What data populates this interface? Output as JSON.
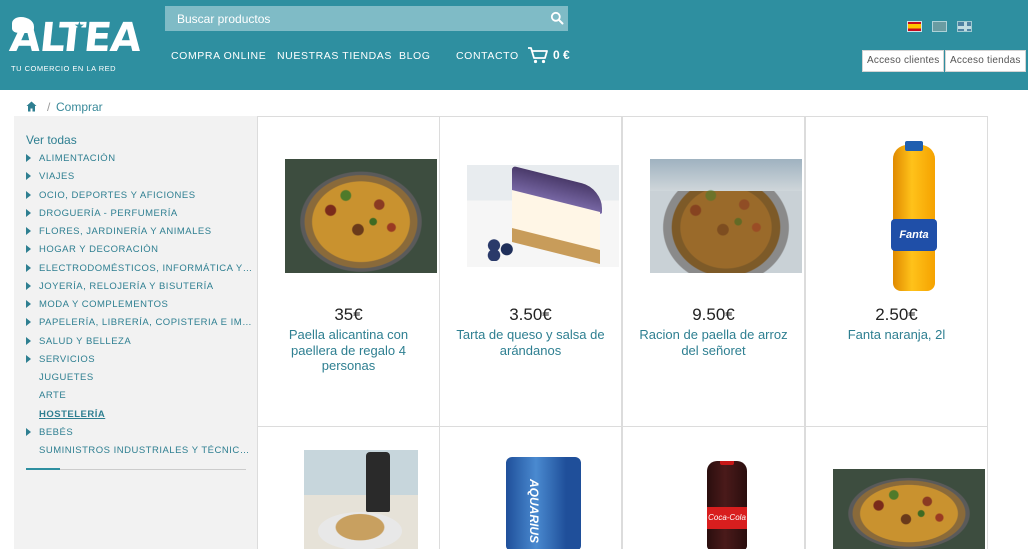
{
  "header": {
    "logo_text": "ALTEA",
    "logo_tagline": "TU COMERCIO EN LA RED",
    "search_placeholder": "Buscar productos",
    "nav": [
      "COMPRA ONLINE",
      "NUESTRAS TIENDAS",
      "BLOG",
      "CONTACTO"
    ],
    "cart_total": "0 €",
    "languages": [
      "es",
      "va",
      "en"
    ],
    "buttons": {
      "clientes": "Acceso clientes",
      "tiendas": "Acceso tiendas"
    }
  },
  "breadcrumb": {
    "separator": "/",
    "current": "Comprar"
  },
  "sidebar": {
    "ver_todas": "Ver todas",
    "categories": [
      {
        "label": "ALIMENTACIÓN",
        "arrow": true
      },
      {
        "label": "VIAJES",
        "arrow": true
      },
      {
        "label": "OCIO, DEPORTES Y AFICIONES",
        "arrow": true
      },
      {
        "label": "DROGUERÍA - PERFUMERÍA",
        "arrow": true
      },
      {
        "label": "FLORES, JARDINERÍA Y ANIMALES",
        "arrow": true
      },
      {
        "label": "HOGAR Y DECORACIÓN",
        "arrow": true
      },
      {
        "label": "ELECTRODOMÉSTICOS, INFORMÁTICA Y ELE...",
        "arrow": true
      },
      {
        "label": "JOYERÍA, RELOJERÍA Y BISUTERÍA",
        "arrow": true
      },
      {
        "label": "MODA Y COMPLEMENTOS",
        "arrow": true
      },
      {
        "label": "PAPELERÍA, LIBRERÍA, COPISTERIA E IMPREN...",
        "arrow": true
      },
      {
        "label": "SALUD Y BELLEZA",
        "arrow": true
      },
      {
        "label": "SERVICIOS",
        "arrow": true
      },
      {
        "label": "JUGUETES",
        "arrow": false
      },
      {
        "label": "ARTE",
        "arrow": false
      },
      {
        "label": "HOSTELERÍA",
        "arrow": false,
        "active": true
      },
      {
        "label": "BEBÉS",
        "arrow": true
      },
      {
        "label": "SUMINISTROS INDUSTRIALES Y TÉCNICOS",
        "arrow": false
      }
    ]
  },
  "products": [
    {
      "price": "35€",
      "name": "Paella alicantina con paellera de regalo 4 personas",
      "image": "paella-image"
    },
    {
      "price": "3.50€",
      "name": "Tarta de queso y salsa de arándanos",
      "image": "cheesecake-image"
    },
    {
      "price": "9.50€",
      "name": "Racion de paella de arroz del señoret",
      "image": "racion-paella-image"
    },
    {
      "price": "2.50€",
      "name": "Fanta naranja, 2l",
      "image": "fanta-bottle-image"
    },
    {
      "price": "",
      "name": "",
      "image": "drinks-scene-image"
    },
    {
      "price": "",
      "name": "",
      "image": "aquarius-can-image"
    },
    {
      "price": "",
      "name": "",
      "image": "coca-cola-bottle-image"
    },
    {
      "price": "",
      "name": "",
      "image": "paella-image"
    }
  ],
  "image_text": {
    "fanta": "Fanta",
    "aquarius": "AQUARIUS",
    "cocacola": "Coca-Cola"
  },
  "colors": {
    "brand": "#2e8fa0",
    "link": "#2e7f91",
    "sidebar_bg": "#f2f2f2"
  }
}
